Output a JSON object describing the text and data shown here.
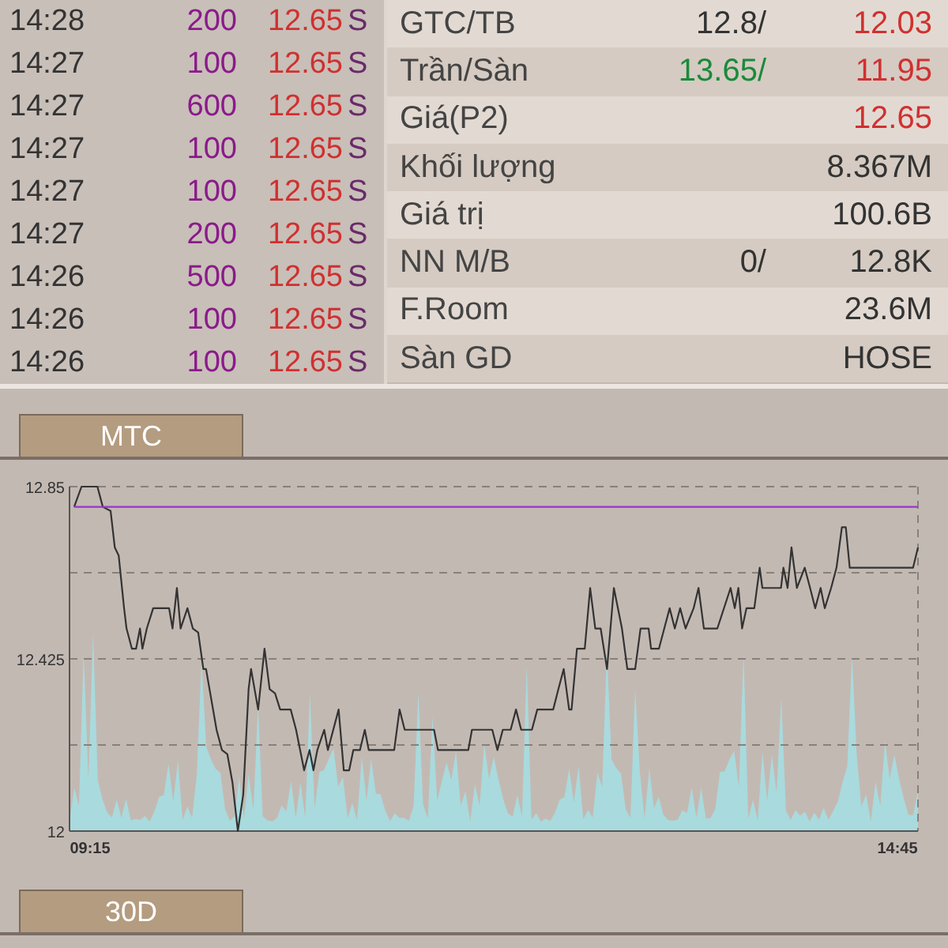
{
  "trades": [
    {
      "time": "14:28",
      "volume": "200",
      "price": "12.65",
      "side": "S"
    },
    {
      "time": "14:27",
      "volume": "100",
      "price": "12.65",
      "side": "S"
    },
    {
      "time": "14:27",
      "volume": "600",
      "price": "12.65",
      "side": "S"
    },
    {
      "time": "14:27",
      "volume": "100",
      "price": "12.65",
      "side": "S"
    },
    {
      "time": "14:27",
      "volume": "100",
      "price": "12.65",
      "side": "S"
    },
    {
      "time": "14:27",
      "volume": "200",
      "price": "12.65",
      "side": "S"
    },
    {
      "time": "14:26",
      "volume": "500",
      "price": "12.65",
      "side": "S"
    },
    {
      "time": "14:26",
      "volume": "100",
      "price": "12.65",
      "side": "S"
    },
    {
      "time": "14:26",
      "volume": "100",
      "price": "12.65",
      "side": "S"
    }
  ],
  "stats": [
    {
      "label": "GTC/TB",
      "value_1": {
        "text": "12.8/",
        "color": "#333333"
      },
      "value_2": {
        "text": "12.03",
        "color": "#d03030"
      }
    },
    {
      "label": "Trần/Sàn",
      "value_1": {
        "text": "13.65/",
        "color": "#1a8a3a"
      },
      "value_2": {
        "text": "11.95",
        "color": "#d03030"
      }
    },
    {
      "label": "Giá(P2)",
      "value_2": {
        "text": "12.65",
        "color": "#d03030"
      }
    },
    {
      "label": "Khối lượng",
      "value_2": {
        "text": "8.367M",
        "color": "#333333"
      }
    },
    {
      "label": "Giá trị",
      "value_2": {
        "text": "100.6B",
        "color": "#333333"
      }
    },
    {
      "label": "NN M/B",
      "value_1": {
        "text": "0/",
        "color": "#333333"
      },
      "value_2": {
        "text": "12.8K",
        "color": "#333333"
      }
    },
    {
      "label": "F.Room",
      "value_2": {
        "text": "23.6M",
        "color": "#333333"
      }
    },
    {
      "label": "Sàn GD",
      "value_2": {
        "text": "HOSE",
        "color": "#333333"
      }
    }
  ],
  "intraday": {
    "tab": "MTC",
    "chart_data": {
      "type": "line",
      "ylim": [
        12,
        12.85
      ],
      "xlim": [
        546.6,
        893.4
      ],
      "yticks": [
        12,
        12.425,
        12.85
      ],
      "xticks": [
        {
          "value": 555,
          "label": "09:15"
        },
        {
          "value": 885,
          "label": "14:45"
        }
      ],
      "x": [
        548.5,
        551.5,
        558.0,
        560.2,
        563.4,
        565.1,
        566.7,
        568.9,
        569.9,
        572.1,
        573.8,
        575.4,
        576.4,
        578.2,
        580.8,
        587.3,
        588.7,
        590.5,
        592.0,
        594.8,
        597.0,
        599.2,
        601.3,
        602.4,
        606.7,
        608.9,
        611.1,
        613.2,
        615.4,
        617.6,
        619.8,
        620.8,
        623.7,
        626.3,
        628.4,
        630.6,
        632.7,
        637.0,
        639.2,
        642.5,
        644.7,
        646.3,
        647.9,
        650.7,
        652.2,
        656.6,
        658.7,
        660.9,
        662.6,
        665.3,
        667.3,
        668.9,
        679.3,
        681.5,
        683.6,
        695.6,
        697.2,
        709.6,
        711.1,
        719.4,
        721.5,
        723.7,
        726.9,
        729.1,
        731.2,
        735.6,
        737.8,
        744.3,
        746.4,
        748.6,
        750.8,
        751.8,
        754.0,
        757.2,
        759.4,
        761.5,
        763.7,
        766.3,
        769.1,
        772.4,
        774.6,
        777.8,
        780.0,
        783.3,
        784.3,
        787.5,
        789.7,
        791.9,
        794.0,
        796.2,
        798.4,
        801.7,
        803.7,
        805.9,
        811.4,
        816.8,
        818.5,
        820.0,
        821.5,
        823.3,
        826.5,
        828.7,
        829.8,
        837.4,
        838.4,
        840.1,
        841.7,
        843.9,
        847.1,
        849.3,
        851.4,
        853.6,
        855.3,
        857.9,
        860.1,
        862.3,
        863.9,
        865.5,
        891.4,
        893.4
      ],
      "series": [
        {
          "color": "#333333",
          "values": [
            12.8,
            12.85,
            12.85,
            12.8,
            12.79,
            12.7,
            12.68,
            12.55,
            12.5,
            12.45,
            12.45,
            12.5,
            12.45,
            12.5,
            12.55,
            12.55,
            12.5,
            12.6,
            12.5,
            12.55,
            12.5,
            12.49,
            12.4,
            12.4,
            12.25,
            12.2,
            12.19,
            12.12,
            12.0,
            12.09,
            12.35,
            12.4,
            12.3,
            12.45,
            12.35,
            12.34,
            12.3,
            12.3,
            12.25,
            12.15,
            12.2,
            12.15,
            12.2,
            12.25,
            12.2,
            12.3,
            12.15,
            12.15,
            12.2,
            12.2,
            12.25,
            12.2,
            12.2,
            12.3,
            12.25,
            12.25,
            12.2,
            12.2,
            12.25,
            12.25,
            12.2,
            12.25,
            12.25,
            12.3,
            12.25,
            12.25,
            12.3,
            12.3,
            12.35,
            12.4,
            12.3,
            12.3,
            12.45,
            12.45,
            12.6,
            12.5,
            12.5,
            12.4,
            12.6,
            12.5,
            12.4,
            12.4,
            12.5,
            12.5,
            12.45,
            12.45,
            12.5,
            12.55,
            12.5,
            12.55,
            12.5,
            12.55,
            12.6,
            12.5,
            12.5,
            12.6,
            12.55,
            12.6,
            12.5,
            12.55,
            12.55,
            12.65,
            12.6,
            12.6,
            12.65,
            12.6,
            12.7,
            12.6,
            12.65,
            12.6,
            12.55,
            12.6,
            12.55,
            12.6,
            12.65,
            12.75,
            12.75,
            12.65,
            12.65,
            12.7
          ]
        },
        {
          "color": "#9933cc",
          "values": [
            12.8,
            12.8,
            12.8,
            12.8,
            12.8,
            12.8,
            12.8,
            12.8,
            12.8,
            12.8,
            12.8,
            12.8,
            12.8,
            12.8,
            12.8,
            12.8,
            12.8,
            12.8,
            12.8,
            12.8,
            12.8,
            12.8,
            12.8,
            12.8,
            12.8,
            12.8,
            12.8,
            12.8,
            12.8,
            12.8,
            12.8,
            12.8,
            12.8,
            12.8,
            12.8,
            12.8,
            12.8,
            12.8,
            12.8,
            12.8,
            12.8,
            12.8,
            12.8,
            12.8,
            12.8,
            12.8,
            12.8,
            12.8,
            12.8,
            12.8,
            12.8,
            12.8,
            12.8,
            12.8,
            12.8,
            12.8,
            12.8,
            12.8,
            12.8,
            12.8,
            12.8,
            12.8,
            12.8,
            12.8,
            12.8,
            12.8,
            12.8,
            12.8,
            12.8,
            12.8,
            12.8,
            12.8,
            12.8,
            12.8,
            12.8,
            12.8,
            12.8,
            12.8,
            12.8,
            12.8,
            12.8,
            12.8,
            12.8,
            12.8,
            12.8,
            12.8,
            12.8,
            12.8,
            12.8,
            12.8,
            12.8,
            12.8,
            12.8,
            12.8,
            12.8,
            12.8,
            12.8,
            12.8,
            12.8,
            12.8,
            12.8,
            12.8,
            12.8,
            12.8,
            12.8,
            12.8,
            12.8,
            12.8,
            12.8,
            12.8,
            12.8,
            12.8,
            12.8,
            12.8,
            12.8,
            12.8,
            12.8,
            12.8,
            12.8,
            12.8
          ]
        }
      ]
    }
  },
  "history": {
    "tab": "30D"
  }
}
